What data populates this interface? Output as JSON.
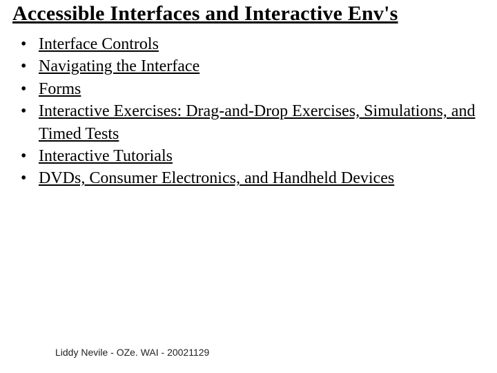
{
  "title": "Accessible Interfaces and Interactive Env's",
  "bullets": [
    {
      "label": "Interface Controls"
    },
    {
      "label": "Navigating the Interface"
    },
    {
      "label": "Forms"
    },
    {
      "label": " Interactive Exercises: Drag-and-Drop Exercises, Simulations, and Timed Tests"
    },
    {
      "label": " Interactive Tutorials"
    },
    {
      "label": " DVDs, Consumer Electronics, and Handheld Devices"
    }
  ],
  "footer": "Liddy Nevile - OZe. WAI - 20021129"
}
